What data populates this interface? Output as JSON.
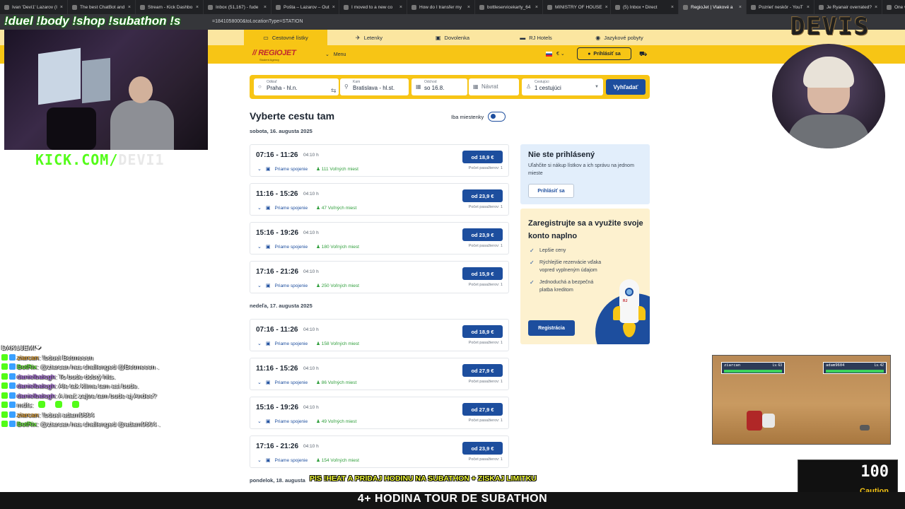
{
  "browser": {
    "tabs": [
      "Ivan 'Devi1' Lazarov (I",
      "The best ChatBot and",
      "Stream - Kick Dashbo",
      "Inbox (51,167) - fude",
      "Pošta – Lazarov – Out",
      "I moved to a new co",
      "How do I transfer my",
      "bottleservicekarty_64",
      "MINISTRY OF HOUSE",
      "(5) Inbox • Direct",
      "RegioJet | Vlakové a",
      "Pozrieť neskôr - YouT",
      "Je Ryanair overrated?",
      "One way to New York"
    ],
    "url_fragment": "=1841058000&toLocationType=STATION"
  },
  "site": {
    "topnav": [
      "Cestovné lístky",
      "Letenky",
      "Dovolenka",
      "RJ Hotels",
      "Jazykové pobyty"
    ],
    "logo": "REGIOJET",
    "logo_sub": "Student Agency",
    "menu": "Menu",
    "currency": "€",
    "login": "Prihlásiť sa",
    "search": {
      "from_label": "Odkiaľ",
      "from_value": "Praha - hl.n.",
      "to_label": "Kam",
      "to_value": "Bratislava - hl.st.",
      "depart_label": "Odchod",
      "depart_value": "so 16.8.",
      "return_placeholder": "Návrat",
      "pax_label": "Cestujúci",
      "pax_value": "1 cestujúci",
      "button": "Vyhľadať"
    },
    "title": "Vyberte cestu tam",
    "toggle_label": "Iba miestenky",
    "day1": "sobota, 16. augusta 2025",
    "day2": "nedeľa, 17. augusta 2025",
    "day3": "pondelok, 18. augusta",
    "connections_day1": [
      {
        "time": "07:16 - 11:26",
        "dur": "04:10 h",
        "type": "Priame spojenie",
        "free": "111 Voľných miest",
        "price": "od 18,9 €",
        "pax": "Počet pasažierov: 1"
      },
      {
        "time": "11:16 - 15:26",
        "dur": "04:10 h",
        "type": "Priame spojenie",
        "free": "47 Voľných miest",
        "price": "od 23,9 €",
        "pax": "Počet pasažierov: 1"
      },
      {
        "time": "15:16 - 19:26",
        "dur": "04:10 h",
        "type": "Priame spojenie",
        "free": "180 Voľných miest",
        "price": "od 23,9 €",
        "pax": "Počet pasažierov: 1"
      },
      {
        "time": "17:16 - 21:26",
        "dur": "04:10 h",
        "type": "Priame spojenie",
        "free": "250 Voľných miest",
        "price": "od 15,9 €",
        "pax": "Počet pasažierov: 1"
      }
    ],
    "connections_day2": [
      {
        "time": "07:16 - 11:26",
        "dur": "04:10 h",
        "type": "Priame spojenie",
        "free": "158 Voľných miest",
        "price": "od 18,9 €",
        "pax": "Počet pasažierov: 1"
      },
      {
        "time": "11:16 - 15:26",
        "dur": "04:10 h",
        "type": "Priame spojenie",
        "free": "86 Voľných miest",
        "price": "od 27,9 €",
        "pax": "Počet pasažierov: 1"
      },
      {
        "time": "15:16 - 19:26",
        "dur": "04:10 h",
        "type": "Priame spojenie",
        "free": "49 Voľných miest",
        "price": "od 27,9 €",
        "pax": "Počet pasažierov: 1"
      },
      {
        "time": "17:16 - 21:26",
        "dur": "04:10 h",
        "type": "Priame spojenie",
        "free": "154 Voľných miest",
        "price": "od 23,9 €",
        "pax": "Počet pasažierov: 1"
      }
    ],
    "box1": {
      "title": "Nie ste prihlásený",
      "text": "Uľahčite si nákup lístkov a ich správu na jednom mieste",
      "button": "Prihlásiť sa"
    },
    "box2": {
      "title": "Zaregistrujte sa a využite svoje konto naplno",
      "items": [
        "Lepšie ceny",
        "Rýchlejšie rezervácie vďaka vopred vyplneným údajom",
        "Jednoduchá a bezpečná platba kreditom"
      ],
      "button": "Registrácia",
      "rocket_tag": "RJ"
    }
  },
  "overlay": {
    "commands": "!duel !body !shop !subathon !s",
    "kick_brand": "KICK.COM/",
    "kick_channel": "DEVI1",
    "devis": "DEVIS",
    "chat": [
      {
        "user": "",
        "msg": "DAKUJEM!❤"
      },
      {
        "user": "ziarcan",
        "msg": ": !bduel Betmeeen",
        "cls": "u1"
      },
      {
        "user": "BotRix",
        "msg": ": @ziarcan has challenged @Betmeeen .",
        "cls": "u2"
      },
      {
        "user": "danielbalogh",
        "msg": ": To bude dobrý hits.",
        "cls": "u3"
      },
      {
        "user": "danielbalogh",
        "msg": ": Ale tak klima tam asi bude.",
        "cls": "u3"
      },
      {
        "user": "danielbalogh",
        "msg": ": A inač zajtra tam bude aj Andee?",
        "cls": "u3"
      },
      {
        "user": "mdfs",
        "msg": ":",
        "cls": ""
      },
      {
        "user": "ziarcan",
        "msg": ": !bduel adam9604",
        "cls": "u1"
      },
      {
        "user": "BotRix",
        "msg": ": @ziarcan has challenged @adam9604 .",
        "cls": "u2"
      }
    ],
    "game": {
      "p1": "ziarcan",
      "p1_lv": "Lv. 63",
      "p2": "adam9604",
      "p2_lv": "Lv. 42"
    },
    "score": "100",
    "caution": "Caution",
    "promo": "PIS !HEAT A PRIDAJ HODINU NA SUBATHON + ZISKAJ LIMITKU",
    "ticker": "4+ HODINA TOUR DE SUBATHON"
  }
}
